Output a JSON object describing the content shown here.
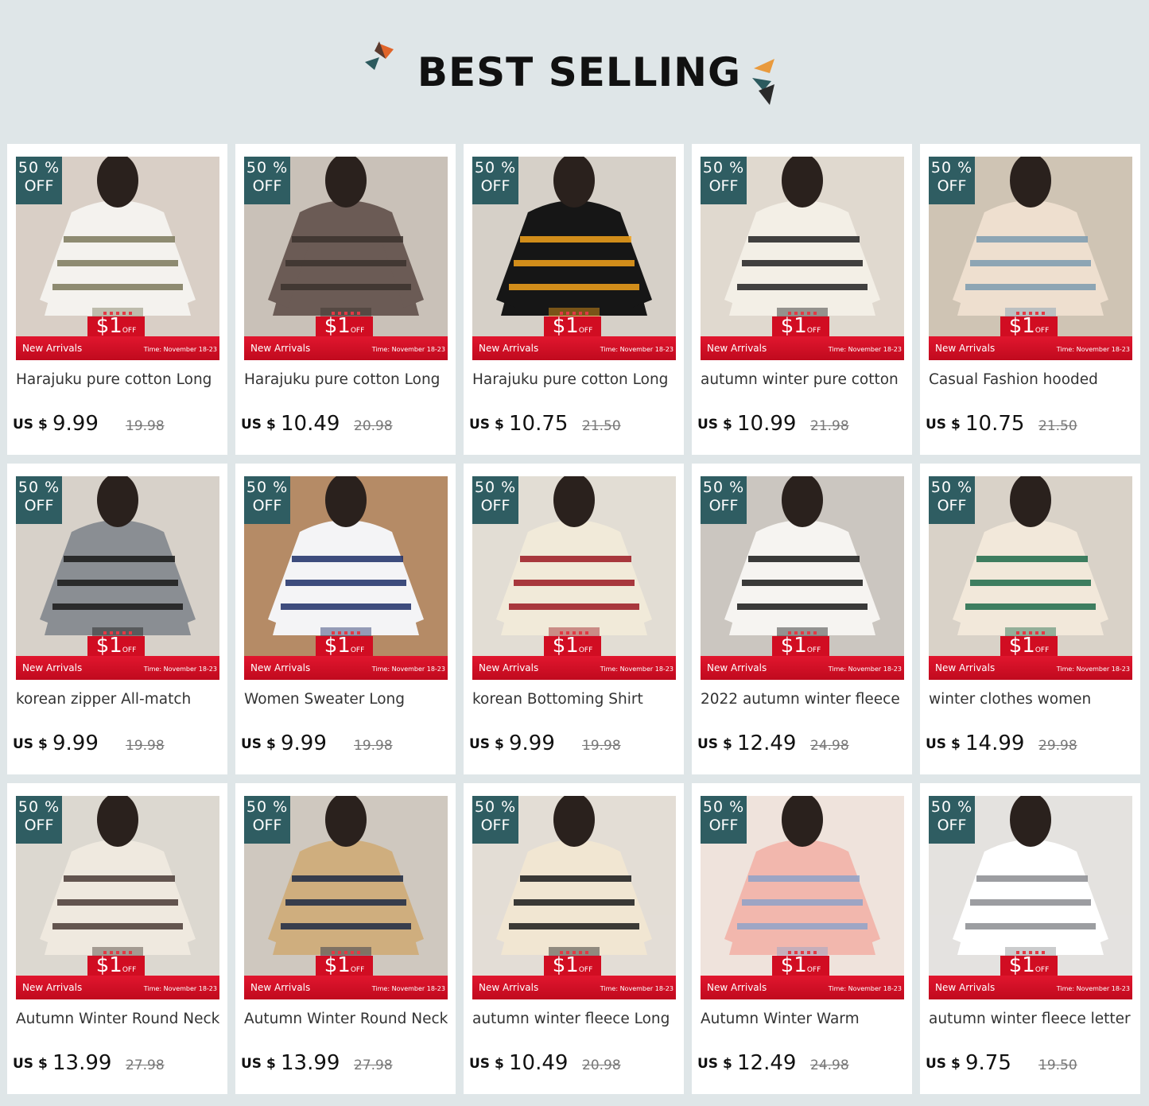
{
  "header": {
    "title": "BEST SELLING"
  },
  "colors": {
    "badge": "#2f5d62",
    "banner": "#d4101f",
    "background": "#dfe6e8"
  },
  "common": {
    "badge_pct": "50 %",
    "badge_off": "OFF",
    "coupon_amount": "$1",
    "coupon_off": "OFF",
    "banner_label": "New Arrivals",
    "banner_time": "Time: November 18-23",
    "currency": "US $"
  },
  "products": [
    {
      "title": "Harajuku pure cotton Long",
      "price": "9.99",
      "original": "19.98",
      "palette": [
        "#d9cfc6",
        "#f4f2ee",
        "#7d7a5c"
      ]
    },
    {
      "title": "Harajuku pure cotton Long",
      "price": "10.49",
      "original": "20.98",
      "palette": [
        "#c9c1b8",
        "#6b5b55",
        "#3c322e"
      ]
    },
    {
      "title": "Harajuku pure cotton Long",
      "price": "10.75",
      "original": "21.50",
      "palette": [
        "#d6d0c8",
        "#161616",
        "#f2a21b"
      ]
    },
    {
      "title": "autumn winter pure cotton",
      "price": "10.99",
      "original": "21.98",
      "palette": [
        "#e0d9cf",
        "#f3efe6",
        "#222222"
      ]
    },
    {
      "title": "Casual Fashion hooded",
      "price": "10.75",
      "original": "21.50",
      "palette": [
        "#cfc4b4",
        "#eedfcf",
        "#7d9bb0"
      ]
    },
    {
      "title": "korean zipper All-match",
      "price": "9.99",
      "original": "19.98",
      "palette": [
        "#d7d1c9",
        "#8a8e93",
        "#1a1a1a"
      ]
    },
    {
      "title": "Women Sweater Long",
      "price": "9.99",
      "original": "19.98",
      "palette": [
        "#b58b66",
        "#f4f4f6",
        "#1e2f69"
      ]
    },
    {
      "title": "korean Bottoming Shirt",
      "price": "9.99",
      "original": "19.98",
      "palette": [
        "#e2ddd4",
        "#f1ead9",
        "#9c1a22"
      ]
    },
    {
      "title": "2022 autumn winter fleece",
      "price": "12.49",
      "original": "24.98",
      "palette": [
        "#cbc6c0",
        "#f6f4f1",
        "#1a1a1a"
      ]
    },
    {
      "title": "winter clothes women",
      "price": "14.99",
      "original": "29.98",
      "palette": [
        "#d9d2c8",
        "#f2e8da",
        "#1f6b4a"
      ]
    },
    {
      "title": "Autumn Winter Round Neck",
      "price": "13.99",
      "original": "27.98",
      "palette": [
        "#dcd8d0",
        "#efe9df",
        "#4a3b36"
      ]
    },
    {
      "title": "Autumn Winter Round Neck",
      "price": "13.99",
      "original": "27.98",
      "palette": [
        "#cfc8bf",
        "#cfae7e",
        "#1d2a44"
      ]
    },
    {
      "title": "autumn winter fleece Long",
      "price": "10.49",
      "original": "20.98",
      "palette": [
        "#e3ddd5",
        "#f1e6d2",
        "#1b1b1b"
      ]
    },
    {
      "title": "Autumn Winter Warm",
      "price": "12.49",
      "original": "24.98",
      "palette": [
        "#efe3dc",
        "#f2b7ad",
        "#8fa3c9"
      ]
    },
    {
      "title": "autumn winter fleece letter",
      "price": "9.75",
      "original": "19.50",
      "palette": [
        "#e4e2df",
        "#ffffff",
        "#8b8d91"
      ]
    }
  ]
}
